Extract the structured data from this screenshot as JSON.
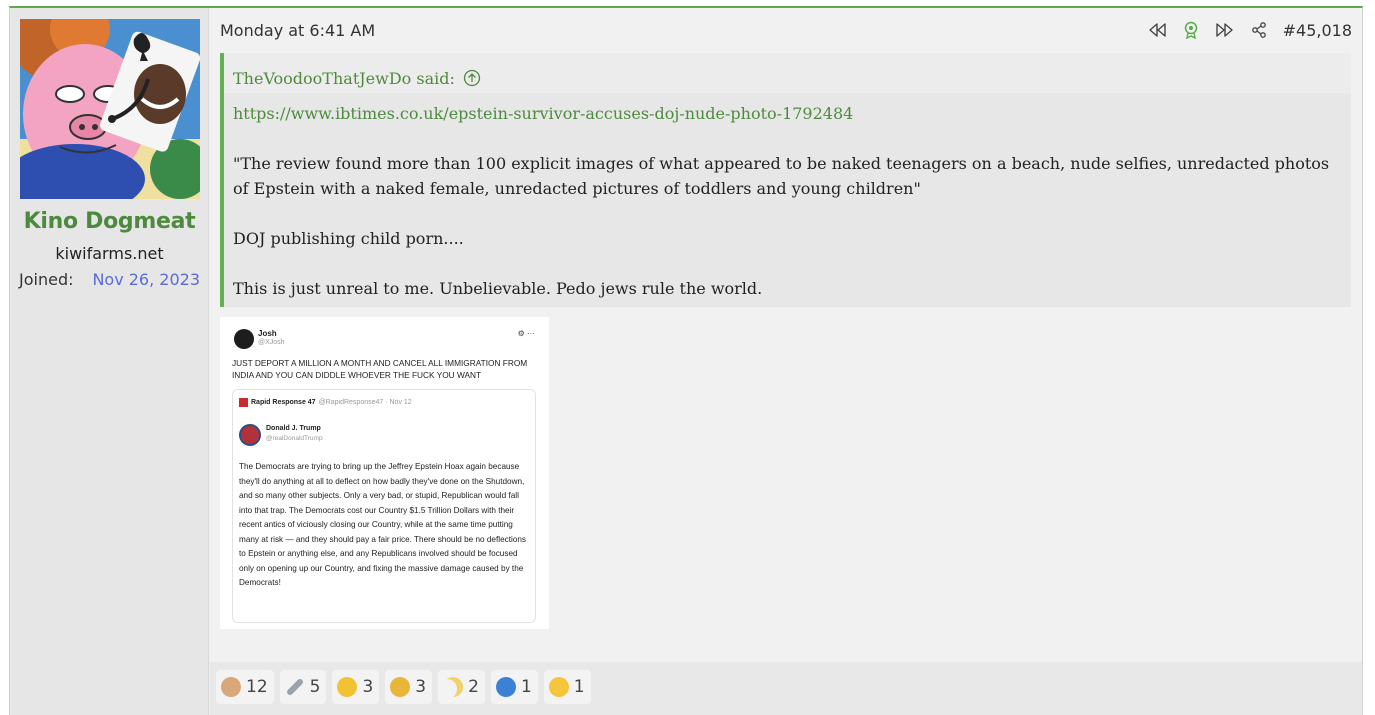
{
  "user": {
    "name": "Kino Dogmeat",
    "title": "kiwifarms.net",
    "joined_label": "Joined:",
    "joined_value": "Nov 26, 2023"
  },
  "post": {
    "date": "Monday at 6:41 AM",
    "number": "#45,018",
    "actions": [
      "rewind-icon",
      "award-icon",
      "forward-icon",
      "share-icon"
    ]
  },
  "quote": {
    "author": "TheVoodooThatJewDo said:",
    "paragraphs": [
      "https://www.ibtimes.co.uk/epstein-survivor-accuses-doj-nude-photo-1792484",
      "\"The review found more than 100 explicit images of what appeared to be naked teenagers on a beach, nude selfies, unredacted photos of Epstein with a naked female, unredacted pictures of toddlers and young children\"",
      "DOJ publishing child porn....",
      "This is just unreal to me. Unbelievable. Pedo jews rule the world."
    ]
  },
  "embed": {
    "name": "Josh",
    "handle": "@XJosh",
    "text": "JUST DEPORT A MILLION A MONTH AND CANCEL ALL IMMIGRATION FROM INDIA AND YOU CAN DIDDLE WHOEVER THE FUCK YOU WANT",
    "quoted_account": "Rapid Response 47",
    "quoted_meta": "@RapidResponse47 · Nov 12",
    "inner_name": "Donald J. Trump",
    "inner_handle": "@realDonaldTrump",
    "inner_text": "The Democrats are trying to bring up the Jeffrey Epstein Hoax again because they'll do anything at all to deflect on how badly they've done on the Shutdown, and so many other subjects. Only a very bad, or stupid, Republican would fall into that trap. The Democrats cost our Country $1.5 Trillion Dollars with their recent antics of viciously closing our Country, while at the same time putting many at risk — and they should pay a fair price. There should be no deflections to Epstein or anything else, and any Republicans involved should be focused only on opening up our Country, and fixing the massive damage caused by the Democrats!"
  },
  "reactions": [
    {
      "icon": "face-icon",
      "count": "12",
      "color": "#d9a77a"
    },
    {
      "icon": "wrench-icon",
      "count": "5",
      "color": "#9aa3ad"
    },
    {
      "icon": "cross-icon",
      "count": "3",
      "color": "#f1c232"
    },
    {
      "icon": "medal-icon",
      "count": "3",
      "color": "#e8b73a"
    },
    {
      "icon": "moon-icon",
      "count": "2",
      "color": "#f2d16b"
    },
    {
      "icon": "thumbs-up-icon",
      "count": "1",
      "color": "#3b82d6"
    },
    {
      "icon": "thinking-icon",
      "count": "1",
      "color": "#f6c53c"
    }
  ]
}
